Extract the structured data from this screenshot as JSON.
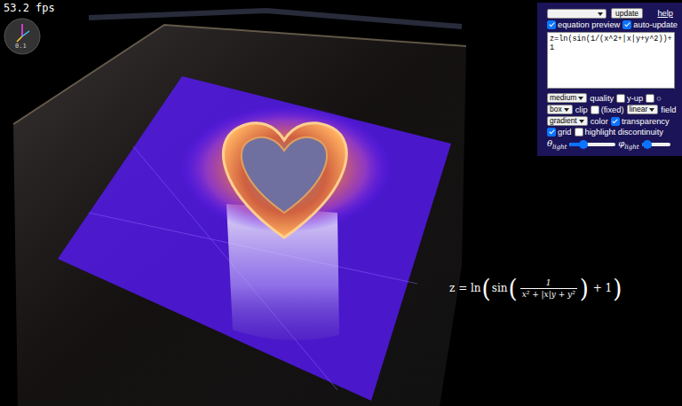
{
  "fps": "53.2 fps",
  "gizmo": {
    "label": "0.1"
  },
  "panel": {
    "rows": [
      {
        "controls": [
          {
            "kind": "select",
            "value": ""
          },
          {
            "kind": "button",
            "label": "update"
          },
          {
            "kind": "link",
            "label": "help"
          }
        ]
      },
      {
        "controls": [
          {
            "kind": "checkbox",
            "label": "equation preview",
            "checked": true
          },
          {
            "kind": "checkbox",
            "label": "auto-update",
            "checked": true
          }
        ]
      },
      {
        "controls": [
          {
            "kind": "textarea",
            "value": "z=ln(sin(1/(x^2+|x|y+y^2))+\n1"
          }
        ]
      },
      {
        "controls": [
          {
            "kind": "select",
            "value": "medium"
          },
          {
            "kind": "text",
            "label": "quality"
          },
          {
            "kind": "checkbox",
            "label": "y-up",
            "checked": false
          },
          {
            "kind": "checkbox",
            "label": "○",
            "checked": false
          }
        ]
      },
      {
        "controls": [
          {
            "kind": "select",
            "value": "box"
          },
          {
            "kind": "text",
            "label": "clip"
          },
          {
            "kind": "checkbox",
            "label": "(fixed)",
            "checked": false
          },
          {
            "kind": "select",
            "value": "linear"
          },
          {
            "kind": "text",
            "label": "field"
          }
        ]
      },
      {
        "controls": [
          {
            "kind": "select",
            "value": "gradient"
          },
          {
            "kind": "text",
            "label": "color"
          },
          {
            "kind": "checkbox",
            "label": "transparency",
            "checked": true
          }
        ]
      },
      {
        "controls": [
          {
            "kind": "checkbox",
            "label": "grid",
            "checked": true
          },
          {
            "kind": "checkbox",
            "label": "highlight discontinuity",
            "checked": false
          }
        ]
      },
      {
        "controls": [
          {
            "kind": "slider",
            "label": "θ",
            "sub": "light",
            "level": 0.3
          },
          {
            "kind": "slider",
            "label": "φ",
            "sub": "light",
            "level": 0.2
          }
        ]
      }
    ]
  },
  "equation": [
    {
      "kind": "text",
      "text": "z = ln"
    },
    {
      "kind": "paren",
      "text": "("
    },
    {
      "kind": "text",
      "text": "sin"
    },
    {
      "kind": "paren",
      "text": "("
    },
    {
      "kind": "frac",
      "num": "1",
      "den": "x² + |x|y + y²"
    },
    {
      "kind": "paren",
      "text": ")"
    },
    {
      "kind": "text",
      "text": " + 1"
    },
    {
      "kind": "paren",
      "text": ")"
    }
  ]
}
